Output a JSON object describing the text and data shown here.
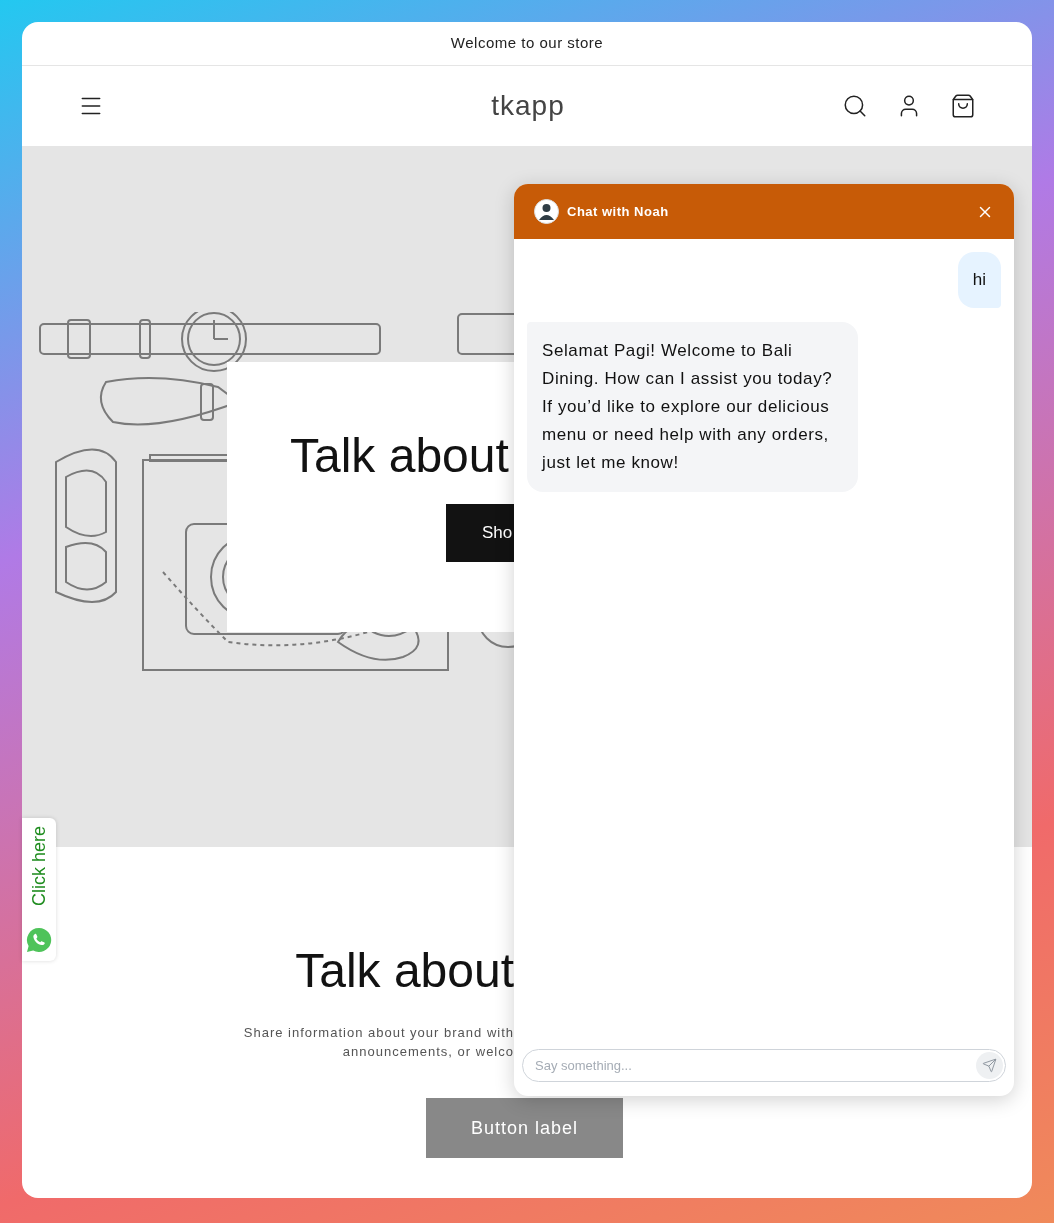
{
  "announcement": "Welcome to our store",
  "header": {
    "logo": "tkapp"
  },
  "hero": {
    "heading": "Talk about",
    "button": "Sho"
  },
  "section": {
    "heading": "Talk about",
    "text_lines": [
      "Share information about your brand with",
      "announcements, or welco"
    ],
    "button": "Button label"
  },
  "whatsapp_tab": {
    "label": "Click here"
  },
  "chat": {
    "title": "Chat with Noah",
    "messages": [
      {
        "kind": "user",
        "text": "hi"
      },
      {
        "kind": "bot",
        "text": "Selamat Pagi! Welcome to Bali Dining. How can I assist you today? If you’d like to explore our delicious menu or need help with any orders, just let me know!"
      }
    ],
    "input": {
      "placeholder": "Say something..."
    }
  }
}
